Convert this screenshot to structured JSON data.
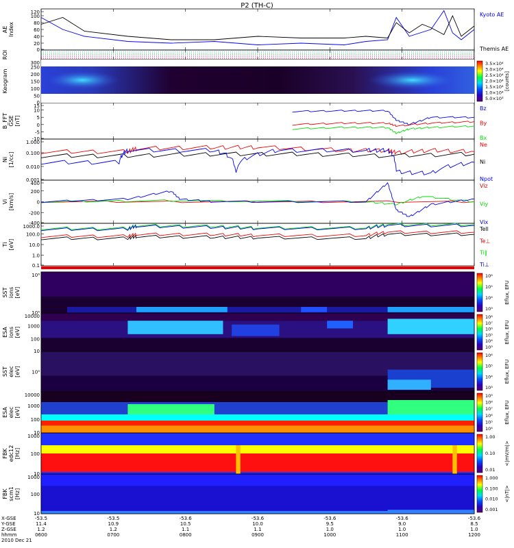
{
  "title": "P2 (TH-C)",
  "x_ticks": [
    "0600",
    "0700",
    "0800",
    "0900",
    "1000",
    "1100",
    "1200"
  ],
  "ephemeris": {
    "row_labels": [
      "X-GSE",
      "Y-GSE",
      "Z-GSE",
      "hhmm",
      "2010 Dec 21"
    ],
    "columns": [
      [
        "-53.5",
        "11.4",
        "1.2",
        "0600"
      ],
      [
        "-53.5",
        "10.9",
        "1.2",
        "0700"
      ],
      [
        "-53.6",
        "10.5",
        "1.1",
        "0800"
      ],
      [
        "-53.6",
        "10.0",
        "1.1",
        "0900"
      ],
      [
        "-53.6",
        "9.5",
        "1.0",
        "1000"
      ],
      [
        "-53.6",
        "9.0",
        "1.0",
        "1100"
      ],
      [
        "-53.6",
        "8.5",
        "1.0",
        "1200"
      ]
    ]
  },
  "colors": {
    "blue": "#0000ee",
    "red": "#ee0000",
    "green": "#00dd00",
    "black": "#000000"
  },
  "chart_data": [
    {
      "type": "line",
      "ylabel": "AE Index",
      "yticks": [
        "120",
        "100",
        "80",
        "60",
        "40",
        "20",
        "0"
      ],
      "ylim": [
        0,
        120
      ],
      "legend": [
        "Kyoto AE",
        "Themis AE"
      ],
      "series": [
        {
          "name": "Kyoto AE",
          "color": "#0000ee",
          "x": [
            0,
            0.05,
            0.1,
            0.2,
            0.3,
            0.4,
            0.5,
            0.6,
            0.7,
            0.75,
            0.8,
            0.82,
            0.85,
            0.9,
            0.93,
            0.95,
            0.97,
            1.0
          ],
          "values": [
            95,
            60,
            40,
            25,
            20,
            25,
            15,
            20,
            15,
            25,
            30,
            95,
            40,
            60,
            115,
            50,
            30,
            60
          ]
        },
        {
          "name": "Themis AE",
          "color": "#000000",
          "x": [
            0,
            0.05,
            0.1,
            0.2,
            0.3,
            0.4,
            0.5,
            0.6,
            0.7,
            0.75,
            0.8,
            0.82,
            0.85,
            0.88,
            0.9,
            0.93,
            0.95,
            0.97,
            1.0
          ],
          "values": [
            75,
            95,
            55,
            40,
            30,
            30,
            40,
            35,
            35,
            40,
            35,
            80,
            50,
            75,
            65,
            45,
            100,
            40,
            70
          ]
        }
      ]
    },
    {
      "type": "line",
      "ylabel": "ROI",
      "yticks": [],
      "series": []
    },
    {
      "type": "heatmap",
      "ylabel": "Keogram",
      "yticks": [
        "300",
        "250",
        "200",
        "150",
        "100",
        "50",
        "0"
      ],
      "colorbar": {
        "ticks": [
          "3.5×10⁴",
          "3.0×10⁴",
          "2.5×10⁴",
          "2.0×10⁴",
          "1.5×10⁴",
          "1.0×10⁴",
          "5.0×10³"
        ],
        "label": "[counts]"
      }
    },
    {
      "type": "line",
      "ylabel": "B_FFT GSE [nT]",
      "yticks": [
        "15",
        "10",
        "5",
        "0",
        "-5",
        "-10"
      ],
      "ylim": [
        -10,
        15
      ],
      "legend": [
        "Bz",
        "By",
        "Bx"
      ],
      "series": [
        {
          "name": "Bz",
          "color": "#0000ee",
          "x": [
            0.58,
            0.7,
            0.8,
            0.82,
            0.85,
            0.9,
            1.0
          ],
          "values": [
            9,
            9.5,
            9.5,
            3,
            0,
            5,
            5
          ]
        },
        {
          "name": "By",
          "color": "#ee0000",
          "x": [
            0.58,
            0.7,
            0.8,
            0.82,
            0.9,
            1.0
          ],
          "values": [
            0,
            1,
            1,
            -1,
            1,
            2
          ]
        },
        {
          "name": "Bx",
          "color": "#00dd00",
          "x": [
            0.58,
            0.7,
            0.8,
            0.82,
            0.85,
            0.9,
            1.0
          ],
          "values": [
            -3,
            -2,
            -2,
            -6,
            -3,
            -2,
            -1
          ]
        }
      ]
    },
    {
      "type": "line",
      "ylabel": "Ni [1/cc]",
      "yticks": [
        "1.000",
        "0.100",
        "0.010",
        "0.001"
      ],
      "legend": [
        "Ne",
        "Ni",
        "Npot"
      ],
      "series": [
        {
          "name": "Ne",
          "color": "#ee0000",
          "x": [
            0,
            0.2,
            0.22,
            0.4,
            0.5,
            0.7,
            0.8,
            0.82,
            0.9,
            1.0
          ],
          "values": [
            0.12,
            0.12,
            0.2,
            0.25,
            0.25,
            0.15,
            0.15,
            0.1,
            0.15,
            0.12
          ]
        },
        {
          "name": "Ni",
          "color": "#000000",
          "x": [
            0,
            0.2,
            0.4,
            0.6,
            0.8,
            1.0
          ],
          "values": [
            0.06,
            0.06,
            0.08,
            0.08,
            0.06,
            0.08
          ]
        },
        {
          "name": "Npot",
          "color": "#0000ee",
          "x": [
            0,
            0.18,
            0.2,
            0.4,
            0.45,
            0.55,
            0.75,
            0.8,
            0.82,
            0.9,
            1.0
          ],
          "values": [
            0.02,
            0.02,
            0.15,
            0.15,
            0.004,
            0.15,
            0.15,
            0.15,
            0.004,
            0.003,
            0.02
          ]
        }
      ]
    },
    {
      "type": "line",
      "ylabel": "Vi [km/s]",
      "yticks": [
        "400",
        "200",
        "0",
        "-200",
        "-400"
      ],
      "ylim": [
        -400,
        400
      ],
      "legend": [
        "Viz",
        "Viy",
        "Vix"
      ],
      "series": [
        {
          "name": "Viz",
          "color": "#ee0000",
          "x": [
            0,
            0.5,
            1.0
          ],
          "values": [
            0,
            0,
            0
          ]
        },
        {
          "name": "Viy",
          "color": "#00dd00",
          "x": [
            0,
            0.3,
            0.75,
            0.82,
            0.88,
            1.0
          ],
          "values": [
            0,
            20,
            0,
            -50,
            100,
            0
          ]
        },
        {
          "name": "Vix",
          "color": "#0000ee",
          "x": [
            0,
            0.2,
            0.3,
            0.32,
            0.4,
            0.75,
            0.8,
            0.82,
            0.85,
            0.9,
            1.0
          ],
          "values": [
            0,
            50,
            200,
            50,
            0,
            0,
            350,
            -150,
            -280,
            -50,
            50
          ]
        }
      ]
    },
    {
      "type": "line",
      "ylabel": "Ti [eV]",
      "yticks": [
        "1000.0",
        "100.0",
        "10.0",
        "1.0",
        "0.1"
      ],
      "legend": [
        "Tell",
        "Te⊥",
        "Ti‖",
        "Ti⊥"
      ],
      "series": [
        {
          "name": "Ti‖",
          "color": "#00dd00",
          "x": [
            0,
            0.2,
            0.22,
            0.4,
            0.5,
            0.75,
            0.8,
            1.0
          ],
          "values": [
            600,
            600,
            1200,
            1000,
            700,
            700,
            1500,
            1500
          ]
        },
        {
          "name": "Ti⊥",
          "color": "#0000ee",
          "x": [
            0,
            0.2,
            0.22,
            0.4,
            0.5,
            0.75,
            0.8,
            1.0
          ],
          "values": [
            500,
            500,
            1000,
            800,
            600,
            600,
            1200,
            1200
          ]
        },
        {
          "name": "Te⊥",
          "color": "#ee0000",
          "x": [
            0,
            0.2,
            0.22,
            0.4,
            0.5,
            0.75,
            0.8,
            1.0
          ],
          "values": [
            100,
            100,
            150,
            150,
            120,
            120,
            250,
            250
          ]
        },
        {
          "name": "Tell",
          "color": "#000000",
          "x": [
            0,
            0.2,
            0.22,
            0.4,
            0.5,
            0.75,
            0.8,
            1.0
          ],
          "values": [
            60,
            60,
            90,
            80,
            70,
            60,
            150,
            150
          ]
        }
      ]
    },
    {
      "type": "heatmap",
      "ylabel": "SST ions [eV]",
      "yticks": [
        "10⁶",
        "10⁵"
      ],
      "colorbar": {
        "ticks": [
          "10⁶",
          "10⁵",
          "10⁴",
          "10³"
        ],
        "label": "Eflux, EFU"
      }
    },
    {
      "type": "heatmap",
      "ylabel": "ESA ions [eV]",
      "yticks": [
        "10000",
        "1000",
        "100",
        "10"
      ],
      "colorbar": {
        "ticks": [
          "10⁸",
          "10⁷",
          "10⁶",
          "10⁵",
          "10⁴",
          "10³"
        ],
        "label": "Eflux, EFU"
      }
    },
    {
      "type": "heatmap",
      "ylabel": "SST elec [eV]",
      "yticks": [
        "10⁵"
      ],
      "colorbar": {
        "ticks": [
          "10⁶",
          "10⁵",
          "10⁴",
          "10³"
        ],
        "label": "Eflux, EFU"
      }
    },
    {
      "type": "heatmap",
      "ylabel": "ESA elec [eV]",
      "yticks": [
        "10000",
        "1000",
        "100",
        "10"
      ],
      "colorbar": {
        "ticks": [
          "10⁹",
          "10⁸",
          "10⁷",
          "10⁶",
          "10⁵",
          "10⁴"
        ],
        "label": "Eflux, EFU"
      }
    },
    {
      "type": "heatmap",
      "ylabel": "FBK edc12 [Hz]",
      "yticks": [
        "1000",
        "100",
        "10"
      ],
      "colorbar": {
        "ticks": [
          "1.00",
          "0.10",
          "0.01"
        ],
        "label": "<|mV/m|>"
      }
    },
    {
      "type": "heatmap",
      "ylabel": "FBK scm1 [Hz]",
      "yticks": [
        "1000",
        "100",
        "10"
      ],
      "colorbar": {
        "ticks": [
          "1.000",
          "0.100",
          "0.010",
          "0.001"
        ],
        "label": "<|nT|>"
      }
    }
  ]
}
